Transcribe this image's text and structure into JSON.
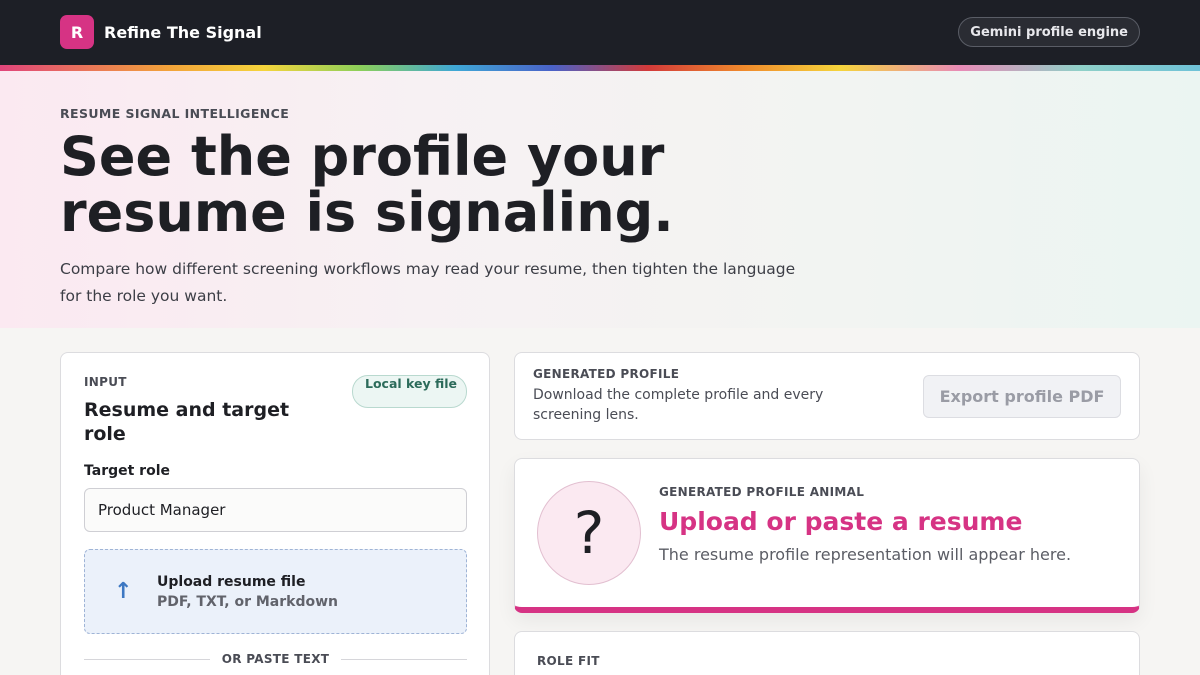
{
  "header": {
    "brand_initial": "R",
    "brand_name": "Refine The Signal",
    "engine_label": "Gemini profile engine"
  },
  "hero": {
    "eyebrow": "RESUME SIGNAL INTELLIGENCE",
    "title": "See the profile your resume is signaling.",
    "subtitle": "Compare how different screening workflows may read your resume, then tighten the language for the role you want."
  },
  "input_panel": {
    "eyebrow": "INPUT",
    "title": "Resume and target role",
    "badge": "Local key file",
    "target_role_label": "Target role",
    "target_role_value": "Product Manager",
    "upload_icon": "upload-arrow-icon",
    "upload_title": "Upload resume file",
    "upload_formats": "PDF, TXT, or Markdown",
    "divider_label": "OR PASTE TEXT"
  },
  "profile_panel": {
    "eyebrow": "GENERATED PROFILE",
    "description": "Download the complete profile and every screening lens.",
    "export_label": "Export profile PDF"
  },
  "animal_panel": {
    "placeholder_glyph": "?",
    "eyebrow": "GENERATED PROFILE ANIMAL",
    "title": "Upload or paste a resume",
    "subtitle": "The resume profile representation will appear here."
  },
  "role_fit": {
    "eyebrow": "ROLE FIT"
  },
  "colors": {
    "brand": "#d63384",
    "topbar": "#1d1f26",
    "upload_bg": "#ebf1fa",
    "badge_green": "#2c6b5a"
  }
}
